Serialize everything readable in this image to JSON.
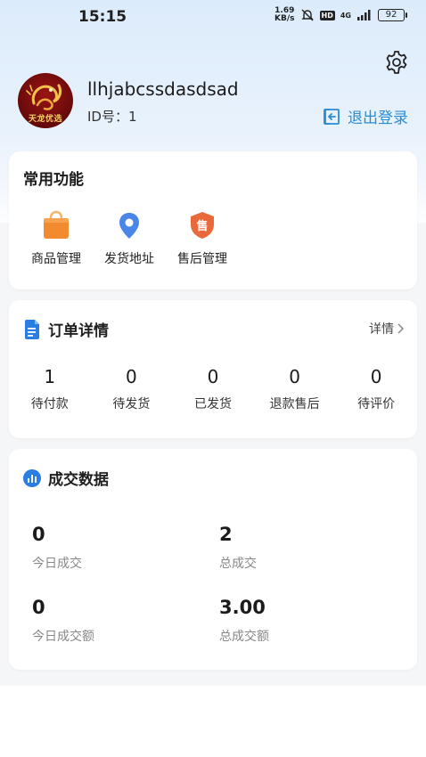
{
  "status_bar": {
    "time": "15:15",
    "net_speed_value": "1.69",
    "net_speed_unit": "KB/s",
    "hd_label": "HD",
    "network": "4G",
    "battery": "92"
  },
  "profile": {
    "username": "llhjabcssdasdsad",
    "id_label": "ID号：1",
    "avatar_text": "天龙优选",
    "logout_label": "退出登录"
  },
  "functions": {
    "title": "常用功能",
    "items": [
      {
        "label": "商品管理",
        "icon": "shopping-bag-icon"
      },
      {
        "label": "发货地址",
        "icon": "location-pin-icon"
      },
      {
        "label": "售后管理",
        "icon": "after-sale-shield-icon"
      }
    ],
    "shield_char": "售"
  },
  "orders": {
    "title": "订单详情",
    "detail_label": "详情",
    "items": [
      {
        "count": "1",
        "label": "待付款"
      },
      {
        "count": "0",
        "label": "待发货"
      },
      {
        "count": "0",
        "label": "已发货"
      },
      {
        "count": "0",
        "label": "退款售后"
      },
      {
        "count": "0",
        "label": "待评价"
      }
    ]
  },
  "stats": {
    "title": "成交数据",
    "items": [
      {
        "value": "0",
        "label": "今日成交"
      },
      {
        "value": "2",
        "label": "总成交"
      },
      {
        "value": "0",
        "label": "今日成交额"
      },
      {
        "value": "3.00",
        "label": "总成交额"
      }
    ]
  },
  "colors": {
    "accent": "#2a8bd6",
    "orange": "#f28a30",
    "blue_pin": "#4a86e8",
    "shield": "#e86a3a"
  }
}
